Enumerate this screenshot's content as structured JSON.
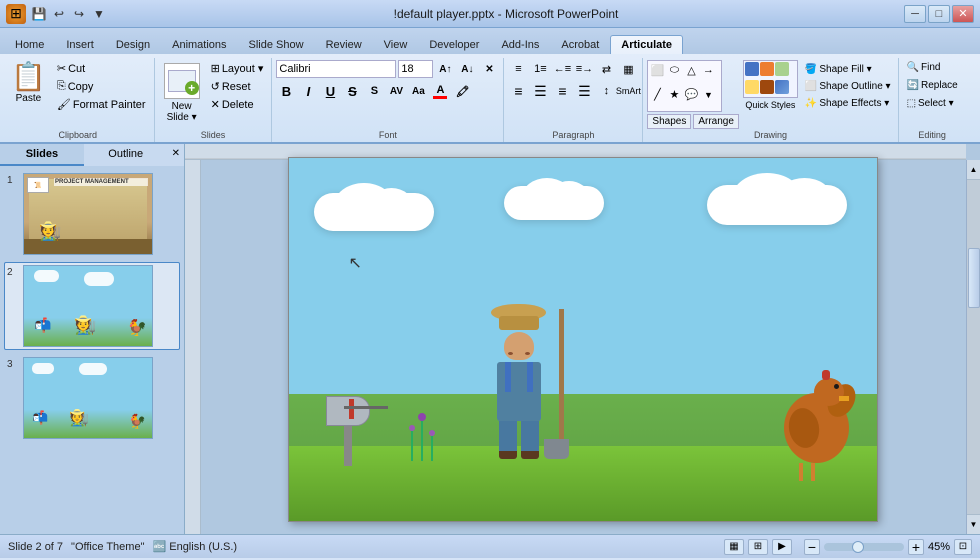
{
  "titlebar": {
    "title": "!default player.pptx - Microsoft PowerPoint",
    "minimize": "─",
    "maximize": "□",
    "close": "✕",
    "quickaccess": [
      "💾",
      "↩",
      "↪",
      "▶"
    ]
  },
  "ribbon": {
    "tabs": [
      "Home",
      "Insert",
      "Design",
      "Animations",
      "Slide Show",
      "Review",
      "View",
      "Developer",
      "Add-Ins",
      "Acrobat",
      "Articulate"
    ],
    "active_tab": "Home",
    "groups": {
      "clipboard": {
        "label": "Clipboard",
        "paste": "Paste",
        "cut": "✂",
        "copy": "⎘",
        "format_painter": "🖌"
      },
      "slides": {
        "label": "Slides",
        "layout": "Layout ▾",
        "reset": "Reset",
        "new_slide": "New\nSlide",
        "delete": "Delete"
      },
      "font": {
        "label": "Font",
        "font_name": "Calibri",
        "font_size": "18",
        "bold": "B",
        "italic": "I",
        "underline": "U",
        "strikethrough": "S",
        "shadow": "S",
        "increase": "A↑",
        "decrease": "A↓",
        "clear": "✕",
        "color": "A",
        "highlight": "🖍"
      },
      "paragraph": {
        "label": "Paragraph",
        "bullets": "≡",
        "numbering": "1≡",
        "indent_out": "←≡",
        "indent_in": "≡→",
        "align_left": "≡←",
        "align_center": "≡",
        "align_right": "≡→",
        "justify": "≡≡",
        "columns": "▦",
        "line_spacing": "↕",
        "direction": "⇄"
      },
      "drawing": {
        "label": "Drawing",
        "shapes_label": "Shapes",
        "arrange_label": "Arrange",
        "quick_styles_label": "Quick\nStyles",
        "shape_fill": "Shape Fill ▾",
        "shape_outline": "Shape Outline ▾",
        "shape_effects": "Shape Effects ▾"
      },
      "editing": {
        "label": "Editing",
        "find": "Find",
        "replace": "Replace",
        "select": "Select ▾"
      }
    }
  },
  "sidebar": {
    "tabs": [
      "Slides",
      "Outline"
    ],
    "active_tab": "Slides",
    "slides": [
      {
        "number": "1",
        "active": false
      },
      {
        "number": "2",
        "active": true
      },
      {
        "number": "3",
        "active": false
      }
    ]
  },
  "canvas": {
    "slide_number": "Slide 2 of 7",
    "theme": "Office Theme"
  },
  "statusbar": {
    "slide_info": "Slide 2 of 7",
    "theme": "\"Office Theme\"",
    "zoom": "45%",
    "view_buttons": [
      "▦",
      "▤",
      "▣"
    ]
  }
}
